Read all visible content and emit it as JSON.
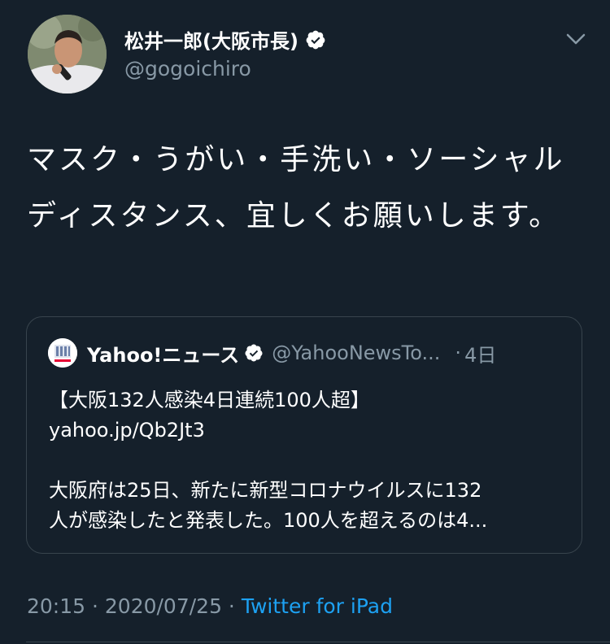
{
  "author": {
    "display_name": "松井一郎(大阪市長)",
    "handle": "@gogoichiro",
    "avatar_icon": "profile-photo-icon",
    "verified_icon": "verified-badge-icon"
  },
  "tweet": {
    "text": "マスク・うがい・手洗い・ソーシャルディスタンス、宜しくお願いします。"
  },
  "quote": {
    "source_name": "Yahoo!ニュース",
    "source_handle": "@YahooNewsTo...",
    "dot": "·",
    "time": "4日",
    "headline": "【大阪132人感染4日連続100人超】",
    "link": "yahoo.jp/Qb2Jt3",
    "body_line1": "大阪府は25日、新たに新型コロナウイルスに132",
    "body_line2": "人が感染したと発表した。100人を超えるのは4..."
  },
  "meta": {
    "time": "20:15",
    "separator": " · ",
    "date": "2020/07/25",
    "source": "Twitter for iPad"
  },
  "colors": {
    "background": "#15202b",
    "secondary_text": "#8899a6",
    "accent": "#1da1f2",
    "border": "#38444d"
  }
}
